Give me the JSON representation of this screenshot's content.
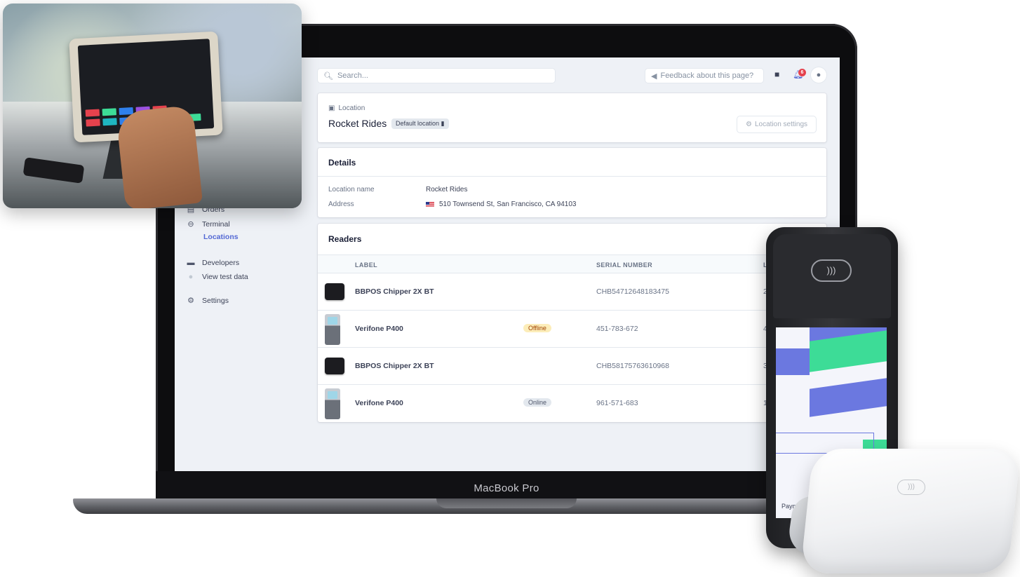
{
  "laptop": {
    "brand": "MacBook Pro"
  },
  "topbar": {
    "search_placeholder": "Search...",
    "feedback_label": "Feedback about this page?",
    "notification_count": "6"
  },
  "sidebar": {
    "items": [
      {
        "label": "Orders",
        "icon": "cart-icon"
      },
      {
        "label": "Terminal",
        "icon": "terminal-icon"
      },
      {
        "label": "Locations",
        "icon": ""
      },
      {
        "label": "Developers",
        "icon": "terminal-window-icon"
      },
      {
        "label": "View test data",
        "icon": "toggle-icon"
      },
      {
        "label": "Settings",
        "icon": "gear-icon"
      }
    ]
  },
  "location": {
    "kicker": "Location",
    "title": "Rocket Rides",
    "badge": "Default location",
    "settings_button": "Location settings"
  },
  "details": {
    "heading": "Details",
    "rows": [
      {
        "label": "Location name",
        "value": "Rocket Rides"
      },
      {
        "label": "Address",
        "value": "510 Townsend St, San Francisco, CA 94103"
      }
    ]
  },
  "readers": {
    "heading": "Readers",
    "columns": [
      "LABEL",
      "SERIAL NUMBER",
      "L"
    ],
    "rows": [
      {
        "label": "BBPOS Chipper 2X BT",
        "status": "",
        "serial": "CHB54712648183475",
        "extra": "2"
      },
      {
        "label": "Verifone P400",
        "status": "Offline",
        "serial": "451-783-672",
        "extra": "4"
      },
      {
        "label": "BBPOS Chipper 2X BT",
        "status": "",
        "serial": "CHB58175763610968",
        "extra": "3"
      },
      {
        "label": "Verifone P400",
        "status": "Online",
        "serial": "961-571-683",
        "extra": "1"
      }
    ]
  },
  "terminal_device": {
    "screen_label": "Payment"
  },
  "colors": {
    "accent": "#5469d4",
    "offline_bg": "#fcedb9",
    "online_bg": "#e3e8ee",
    "terminal_purple": "#6b78e0",
    "terminal_green": "#3ddc97"
  }
}
